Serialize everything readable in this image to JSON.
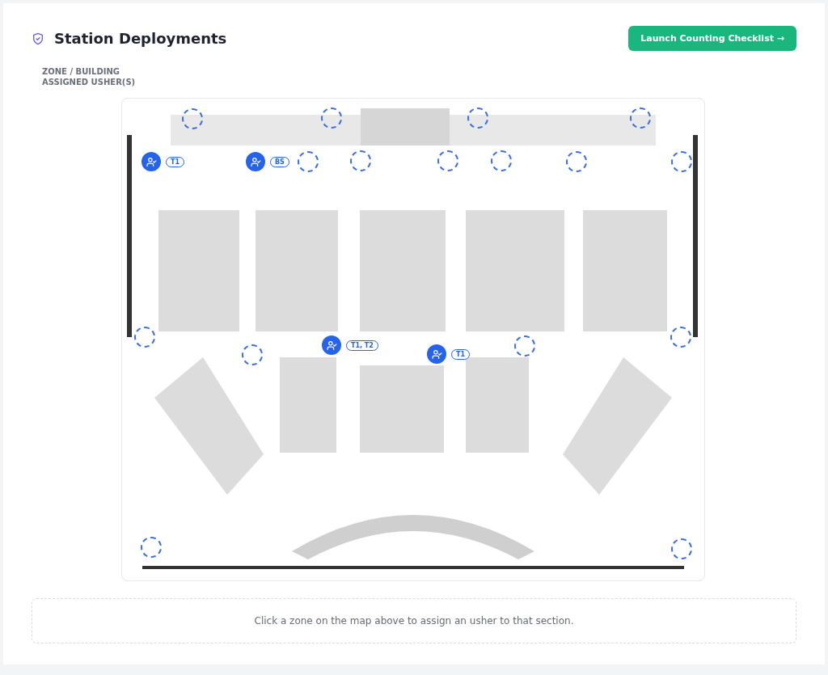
{
  "header": {
    "title": "Station Deployments",
    "action": "Launch Counting Checklist →"
  },
  "legend": [
    "ZONE / BUILDING",
    "ASSIGNED USHER(S)"
  ],
  "map": {
    "kind": "picture",
    "ushers": [
      {
        "tags": "T1"
      },
      {
        "tags": "BS"
      },
      {
        "tags": "T1, T2"
      },
      {
        "tags": "T1"
      }
    ]
  },
  "hint": "Click a zone on the map above to assign an usher to that section."
}
